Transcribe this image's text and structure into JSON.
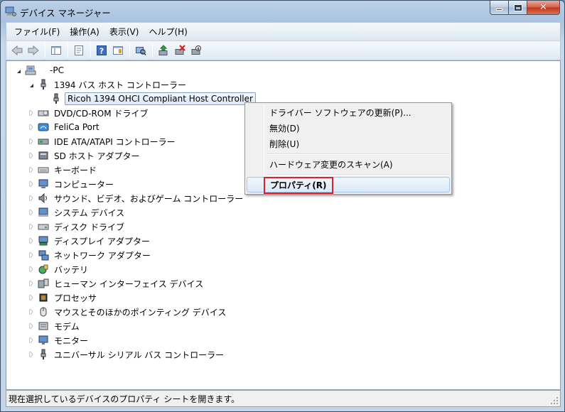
{
  "window": {
    "title": "デバイス マネージャー"
  },
  "menubar": {
    "items": [
      "ファイル(F)",
      "操作(A)",
      "表示(V)",
      "ヘルプ(H)"
    ]
  },
  "tree": {
    "root": "-PC",
    "bus_group": "1394 バス ホスト コントローラー",
    "selected_device": "Ricoh 1394 OHCI Compliant Host Controller",
    "categories": [
      "DVD/CD-ROM ドライブ",
      "FeliCa Port",
      "IDE ATA/ATAPI コントローラー",
      "SD ホスト アダプター",
      "キーボード",
      "コンピューター",
      "サウンド、ビデオ、およびゲーム コントローラー",
      "システム デバイス",
      "ディスク ドライブ",
      "ディスプレイ アダプター",
      "ネットワーク アダプター",
      "バッテリ",
      "ヒューマン インターフェイス デバイス",
      "プロセッサ",
      "マウスとそのほかのポインティング デバイス",
      "モデム",
      "モニター",
      "ユニバーサル シリアル バス コントローラー"
    ]
  },
  "context_menu": {
    "update_driver": "ドライバー ソフトウェアの更新(P)...",
    "disable": "無効(D)",
    "uninstall": "削除(U)",
    "scan": "ハードウェア変更のスキャン(A)",
    "properties": "プロパティ(R)"
  },
  "statusbar": {
    "text": "現在選択しているデバイスのプロパティ シートを開きます。"
  },
  "colors": {
    "highlight_border": "#e0202a",
    "selection": "#dce9f9"
  }
}
